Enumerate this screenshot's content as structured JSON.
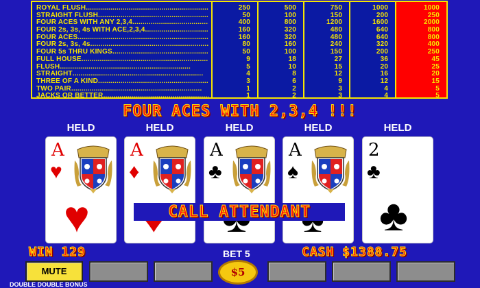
{
  "paytable": {
    "hands": [
      {
        "name": "ROYAL FLUSH",
        "payouts": [
          "250",
          "500",
          "750",
          "1000",
          "1000"
        ]
      },
      {
        "name": "STRAIGHT FLUSH",
        "payouts": [
          "50",
          "100",
          "150",
          "200",
          "250"
        ]
      },
      {
        "name": "FOUR ACES WITH ANY 2,3,4",
        "payouts": [
          "400",
          "800",
          "1200",
          "1600",
          "2000"
        ]
      },
      {
        "name": "FOUR 2s, 3s, 4s WITH ACE,2,3,4.",
        "payouts": [
          "160",
          "320",
          "480",
          "640",
          "800"
        ]
      },
      {
        "name": "FOUR ACES",
        "payouts": [
          "160",
          "320",
          "480",
          "640",
          "800"
        ]
      },
      {
        "name": "FOUR 2s, 3s, 4s",
        "payouts": [
          "80",
          "160",
          "240",
          "320",
          "400"
        ]
      },
      {
        "name": "FOUR 5s THRU KINGS",
        "payouts": [
          "50",
          "100",
          "150",
          "200",
          "250"
        ]
      },
      {
        "name": "FULL HOUSE",
        "payouts": [
          "9",
          "18",
          "27",
          "36",
          "45"
        ]
      },
      {
        "name": "FLUSH",
        "payouts": [
          "5",
          "10",
          "15",
          "20",
          "25"
        ]
      },
      {
        "name": "STRAIGHT",
        "payouts": [
          "4",
          "8",
          "12",
          "16",
          "20"
        ]
      },
      {
        "name": "THREE OF A KIND",
        "payouts": [
          "3",
          "6",
          "9",
          "12",
          "15"
        ]
      },
      {
        "name": "TWO PAIR",
        "payouts": [
          "1",
          "2",
          "3",
          "4",
          "5"
        ]
      },
      {
        "name": "JACKS OR BETTER",
        "payouts": [
          "1",
          "2",
          "3",
          "4",
          "5"
        ]
      }
    ],
    "highlight_color": "#ff0000",
    "border_color": "#f6e500"
  },
  "banner": "FOUR ACES WITH 2,3,4 !!!",
  "cards": [
    {
      "held": "HELD",
      "rank": "A",
      "suit": "♥",
      "suit_name": "hearts",
      "color": "red",
      "face_card": true
    },
    {
      "held": "HELD",
      "rank": "A",
      "suit": "♦",
      "suit_name": "diamonds",
      "color": "red",
      "face_card": true
    },
    {
      "held": "HELD",
      "rank": "A",
      "suit": "♣",
      "suit_name": "clubs",
      "color": "black",
      "face_card": true
    },
    {
      "held": "HELD",
      "rank": "A",
      "suit": "♠",
      "suit_name": "spades",
      "color": "black",
      "face_card": true
    },
    {
      "held": "HELD",
      "rank": "2",
      "suit": "♣",
      "suit_name": "clubs",
      "color": "black",
      "face_card": false
    }
  ],
  "call_attendant": "CALL ATTENDANT",
  "status": {
    "win": "WIN 129",
    "bet": "BET 5",
    "cash": "CASH $1388.75"
  },
  "buttons": {
    "mute": "MUTE",
    "coin": "$5"
  },
  "game_name": "DOUBLE DOUBLE BONUS",
  "colors": {
    "background": "#1f18b8",
    "paytable_text": "#f6e500",
    "retro_text": "#ff1010",
    "button_gray": "#8d8d8d",
    "mute_button": "#f7e13a",
    "coin": "#f5c810"
  }
}
